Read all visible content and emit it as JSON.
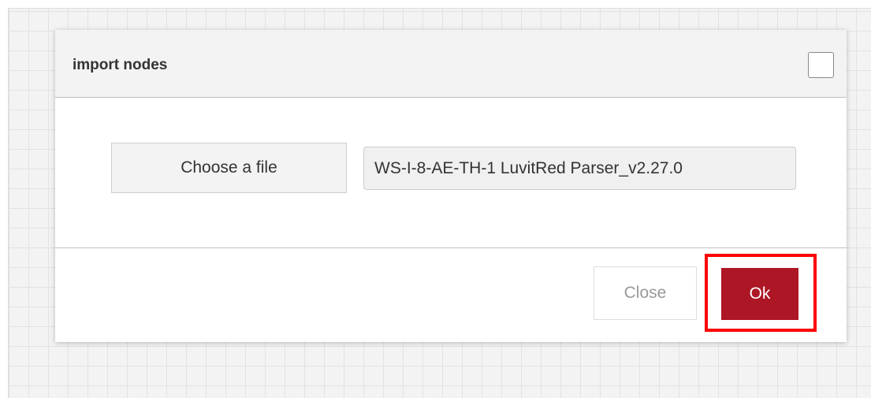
{
  "dialog": {
    "title": "import nodes",
    "choose_file_label": "Choose a file",
    "file_name": "WS-I-8-AE-TH-1 LuvitRed Parser_v2.27.0",
    "close_label": "Close",
    "ok_label": "Ok"
  },
  "colors": {
    "ok_button": "#ad1625",
    "highlight": "#ff0000",
    "workspace_bg": "#f3f3f3"
  }
}
